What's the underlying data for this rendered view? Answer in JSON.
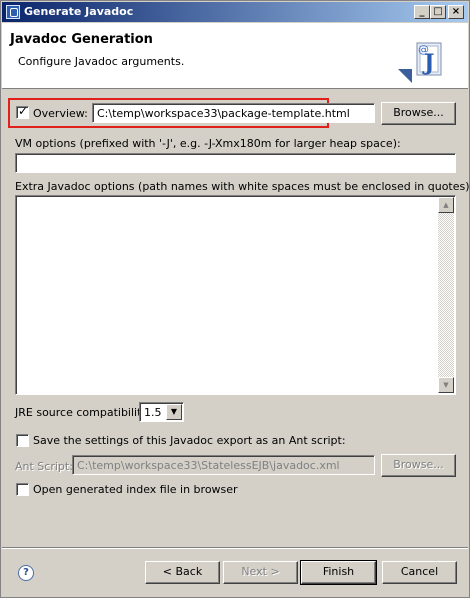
{
  "window": {
    "title": "Generate Javadoc",
    "minimize_glyph": "_",
    "maximize_glyph": "□",
    "close_glyph": "×"
  },
  "header": {
    "title": "Javadoc Generation",
    "subtitle": "Configure Javadoc arguments."
  },
  "overview": {
    "label": "Overview:",
    "checked": true,
    "value": "C:\\temp\\workspace33\\package-template.html",
    "browse_label": "Browse..."
  },
  "vm_options": {
    "label": "VM options (prefixed with '-J', e.g. -J-Xmx180m for larger heap space):",
    "value": ""
  },
  "extra_options": {
    "label": "Extra Javadoc options (path names with white spaces must be enclosed in quotes):",
    "value": ""
  },
  "jre": {
    "label": "JRE source compatibility:",
    "selected": "1.5"
  },
  "ant": {
    "save_label": "Save the settings of this Javadoc export as an Ant script:",
    "save_checked": false,
    "script_label": "Ant Script:",
    "script_value": "C:\\temp\\workspace33\\StatelessEJB\\javadoc.xml",
    "browse_label": "Browse..."
  },
  "open_index": {
    "label": "Open generated index file in browser",
    "checked": false
  },
  "footer": {
    "help_glyph": "?",
    "back_label": "< Back",
    "next_label": "Next >",
    "finish_label": "Finish",
    "cancel_label": "Cancel"
  },
  "icons": {
    "help": "help-icon",
    "javadoc": "javadoc-wizard-icon",
    "app": "eclipse-app-icon",
    "scroll_up": "scroll-up-icon",
    "scroll_down": "scroll-down-icon",
    "dropdown": "chevron-down-icon"
  },
  "colors": {
    "titlebar_start": "#0a246a",
    "titlebar_end": "#a6caf0",
    "dialog_bg": "#d4d0c8",
    "highlight": "#e0211b"
  }
}
